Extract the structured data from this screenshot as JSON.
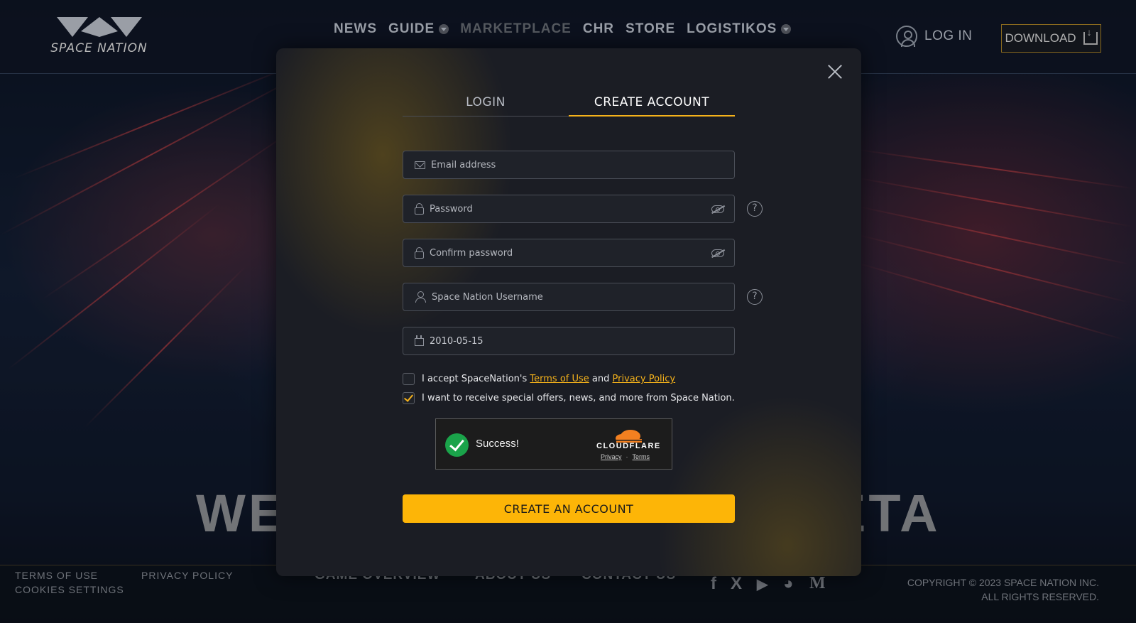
{
  "header": {
    "logo_text": "SPACE NATION",
    "nav": [
      {
        "label": "NEWS",
        "dropdown": false,
        "disabled": false
      },
      {
        "label": "GUIDE",
        "dropdown": true,
        "disabled": false
      },
      {
        "label": "MARKETPLACE",
        "dropdown": false,
        "disabled": true
      },
      {
        "label": "CHR",
        "dropdown": false,
        "disabled": false
      },
      {
        "label": "STORE",
        "dropdown": false,
        "disabled": false
      },
      {
        "label": "LOGISTIKOS",
        "dropdown": true,
        "disabled": false
      }
    ],
    "login_label": "LOG IN",
    "download_label": "DOWNLOAD"
  },
  "background": {
    "headline_left": "WE",
    "headline_right": "ETA"
  },
  "modal": {
    "tabs": {
      "login": "LOGIN",
      "create": "CREATE ACCOUNT",
      "active": "create"
    },
    "fields": {
      "email_placeholder": "Email address",
      "password_placeholder": "Password",
      "confirm_password_placeholder": "Confirm password",
      "username_placeholder": "Space Nation Username",
      "birthdate_value": "2010-05-15"
    },
    "help_glyph": "?",
    "terms": {
      "prefix": "I accept SpaceNation's",
      "terms_link": "Terms of Use",
      "and": "and",
      "privacy_link": "Privacy Policy",
      "checked": false
    },
    "offers": {
      "label": "I want to receive special offers, news, and more from Space Nation.",
      "checked": true
    },
    "captcha": {
      "status": "Success!",
      "provider": "CLOUDFLARE",
      "privacy": "Privacy",
      "separator": "·",
      "terms": "Terms"
    },
    "submit_label": "CREATE AN ACCOUNT"
  },
  "footer": {
    "terms": "TERMS OF USE",
    "cookies": "COOKIES SETTINGS",
    "privacy": "PRIVACY POLICY",
    "nav": [
      "GAME OVERVIEW",
      "ABOUT US",
      "CONTACT US"
    ],
    "social": [
      "facebook-icon",
      "x-icon",
      "youtube-icon",
      "discord-icon",
      "medium-icon"
    ],
    "social_glyphs": [
      "f",
      "X",
      "▶",
      "◕",
      "M"
    ],
    "copyright_line1": "COPYRIGHT © 2023 SPACE NATION INC.",
    "copyright_line2": "ALL RIGHTS RESERVED."
  },
  "colors": {
    "accent": "#fdb507",
    "link": "#f5b21b",
    "captcha_success": "#1aa34a",
    "cloudflare_orange": "#f38020"
  }
}
